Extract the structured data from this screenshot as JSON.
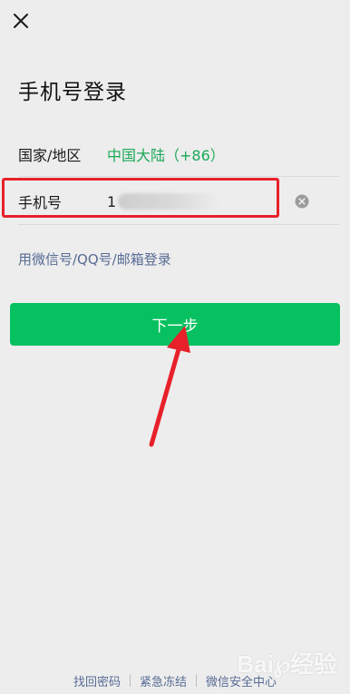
{
  "header": {
    "close_icon": "close-icon",
    "title": "手机号登录"
  },
  "region_row": {
    "label": "国家/地区",
    "value": "中国大陆（+86）"
  },
  "phone_row": {
    "label": "手机号",
    "value_visible": "1",
    "clear_icon": "clear-circle-icon"
  },
  "alt_login": {
    "label": "用微信号/QQ号/邮箱登录"
  },
  "next_button": {
    "label": "下一步"
  },
  "footer": {
    "links": [
      "找回密码",
      "紧急冻结",
      "微信安全中心"
    ]
  },
  "watermark": "Bai℘经验",
  "colors": {
    "background": "#ededed",
    "accent_green": "#07c160",
    "region_text": "#1ba957",
    "link_blue": "#576b95",
    "highlight_red": "#e8202a"
  }
}
